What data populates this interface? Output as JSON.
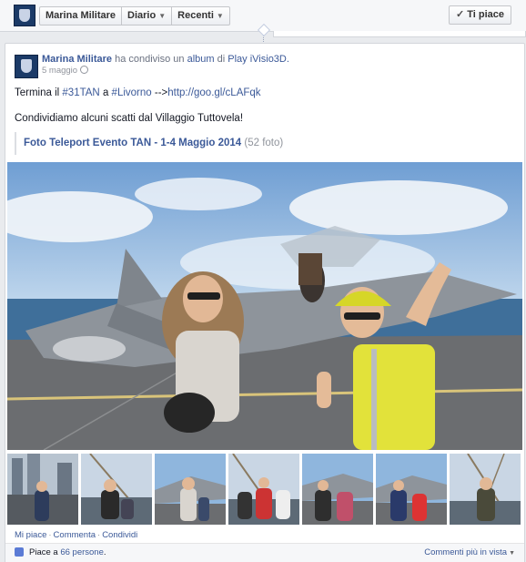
{
  "topbar": {
    "page_name": "Marina Militare",
    "nav": [
      {
        "label": "Diario",
        "caret": "▼"
      },
      {
        "label": "Recenti",
        "caret": "▼"
      }
    ],
    "like_button": {
      "label": "Ti piace",
      "icon": "check-icon"
    }
  },
  "post": {
    "author": "Marina Militare",
    "shared_text": "ha condiviso un",
    "album_word": "album",
    "of_text": "di",
    "source": "Play iVisio3D.",
    "date": "5 maggio",
    "text_prefix": "Termina il ",
    "hashtag1": "#31TAN",
    "text_mid": " a ",
    "hashtag2": "#Livorno",
    "text_arrow": " -->",
    "url": "http://goo.gl/cLAFqk",
    "line2": "Condividiamo alcuni scatti dal Villaggio Tuttovela!",
    "album": {
      "title": "Foto Teleport Evento TAN - 1-4 Maggio 2014",
      "count": "(52 foto)"
    },
    "thumbnails_count": 7,
    "actions": {
      "like": "Mi piace",
      "comment": "Commenta",
      "share": "Condividi",
      "sep": "·"
    },
    "likes": {
      "prefix": "Piace a ",
      "count": "66 persone",
      "suffix": "."
    },
    "sort_label": "Commenti più in vista",
    "sort_caret": "▼"
  },
  "colors": {
    "link": "#3b5998",
    "background": "#e9ebee",
    "sky": "#8fb6dd",
    "sea": "#3f6f9a",
    "deck": "#6b6d70",
    "jet": "#8e949b"
  }
}
